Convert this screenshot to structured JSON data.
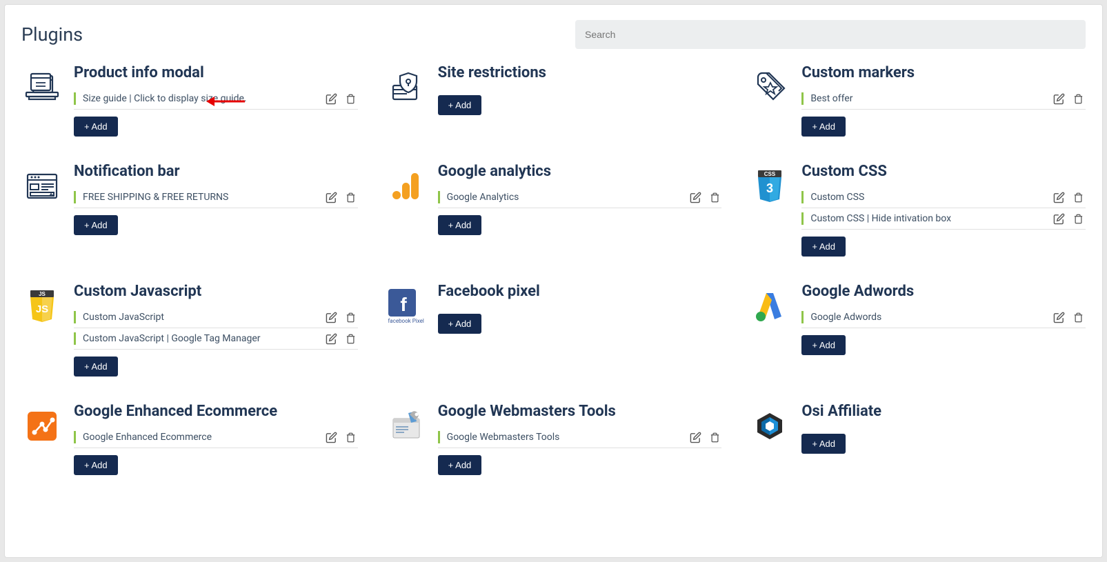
{
  "page_title": "Plugins",
  "search_placeholder": "Search",
  "add_label": "+ Add",
  "plugins": [
    {
      "title": "Product info modal",
      "items": [
        {
          "text": "Size guide | Click to display size guide."
        }
      ],
      "icon": "product-info",
      "has_arrow": true
    },
    {
      "title": "Site restrictions",
      "items": [],
      "icon": "site-restrict"
    },
    {
      "title": "Custom markers",
      "items": [
        {
          "text": "Best offer"
        }
      ],
      "icon": "markers"
    },
    {
      "title": "Notification bar",
      "items": [
        {
          "text": "FREE SHIPPING & FREE RETURNS"
        }
      ],
      "icon": "notif-bar"
    },
    {
      "title": "Google analytics",
      "items": [
        {
          "text": "Google Analytics"
        }
      ],
      "icon": "g-analytics"
    },
    {
      "title": "Custom CSS",
      "items": [
        {
          "text": "Custom CSS"
        },
        {
          "text": "Custom CSS | Hide intivation box"
        }
      ],
      "icon": "css"
    },
    {
      "title": "Custom Javascript",
      "items": [
        {
          "text": "Custom JavaScript"
        },
        {
          "text": "Custom JavaScript | Google Tag Manager"
        }
      ],
      "icon": "js"
    },
    {
      "title": "Facebook pixel",
      "items": [],
      "icon": "fb-pixel",
      "caption": "facebook Pixel"
    },
    {
      "title": "Google Adwords",
      "items": [
        {
          "text": "Google Adwords"
        }
      ],
      "icon": "adwords"
    },
    {
      "title": "Google Enhanced Ecommerce",
      "items": [
        {
          "text": "Google Enhanced Ecommerce"
        }
      ],
      "icon": "g-enhanced"
    },
    {
      "title": "Google Webmasters Tools",
      "items": [
        {
          "text": "Google Webmasters Tools"
        }
      ],
      "icon": "webmasters"
    },
    {
      "title": "Osi Affiliate",
      "items": [],
      "icon": "osi"
    }
  ]
}
